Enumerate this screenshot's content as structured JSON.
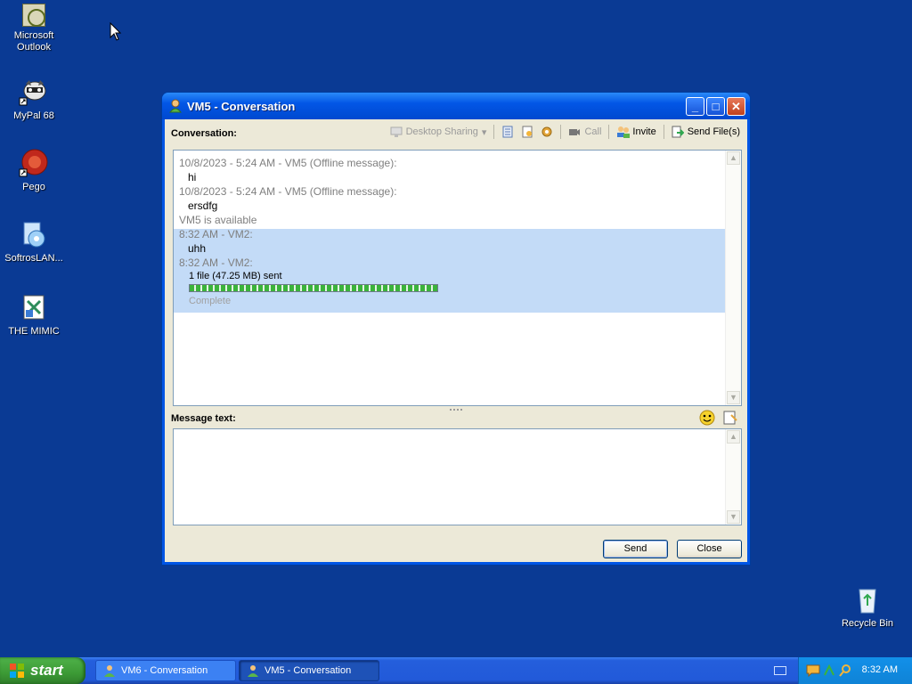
{
  "desktop": {
    "icons": [
      {
        "label": "Microsoft Outlook"
      },
      {
        "label": "MyPal 68"
      },
      {
        "label": "Pego"
      },
      {
        "label": "SoftrosLAN..."
      },
      {
        "label": "THE MIMIC"
      },
      {
        "label": "Recycle Bin"
      }
    ]
  },
  "window": {
    "title": "VM5 - Conversation",
    "controls": {
      "minimize": "_",
      "maximize": "□",
      "close": "✕"
    },
    "toolbar": {
      "conversation_label": "Conversation:",
      "desktop_sharing": "Desktop Sharing",
      "call": "Call",
      "invite": "Invite",
      "send_files": "Send File(s)"
    },
    "conversation": [
      {
        "meta": "10/8/2023 - 5:24 AM - VM5 (Offline message):",
        "text": "hi"
      },
      {
        "meta": "10/8/2023 - 5:24 AM - VM5 (Offline message):",
        "text": "ersdfg"
      },
      {
        "status": "VM5 is available"
      },
      {
        "meta": "8:32 AM - VM2:",
        "text": "uhh"
      },
      {
        "meta": "8:32 AM - VM2:",
        "file_info": "1 file (47.25 MB) sent",
        "progress": 1.0,
        "status": "Complete"
      }
    ],
    "message_label": "Message text:",
    "message_value": "",
    "buttons": {
      "send": "Send",
      "close": "Close"
    }
  },
  "taskbar": {
    "start_label": "start",
    "tasks": [
      {
        "label": "VM6 - Conversation",
        "active": false
      },
      {
        "label": "VM5 - Conversation",
        "active": true
      }
    ],
    "clock": "8:32 AM"
  },
  "colors": {
    "desktop": "#0a3a94",
    "titlebar": "#0256e6",
    "highlight_row": "#c3dbf7",
    "start_button": "#3c9a35"
  }
}
